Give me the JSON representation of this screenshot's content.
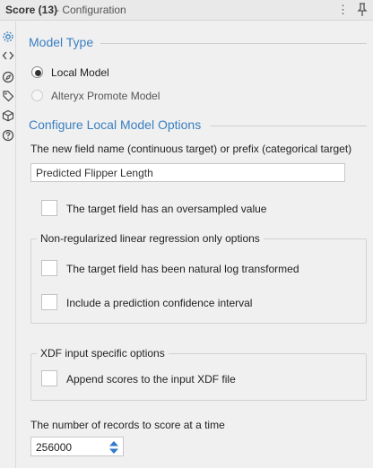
{
  "window": {
    "title": "Score (13)",
    "subtitle": "- Configuration"
  },
  "sidebar": {
    "icons": [
      "gear-icon",
      "code-icon",
      "compass-icon",
      "tag-icon",
      "cube-icon",
      "help-icon"
    ]
  },
  "model_type": {
    "heading": "Model Type",
    "options": [
      {
        "label": "Local Model",
        "selected": true
      },
      {
        "label": "Alteryx Promote Model",
        "selected": false
      }
    ]
  },
  "local_options": {
    "heading": "Configure Local Model Options",
    "field_name_label": "The new field name (continuous target) or prefix (categorical target)",
    "field_name_value": "Predicted Flipper Length",
    "oversampled_label": "The target field has an oversampled value",
    "linreg_group": {
      "title": "Non-regularized linear regression only options",
      "natural_log_label": "The target field has been natural log transformed",
      "confidence_label": "Include a prediction confidence interval"
    },
    "xdf_group": {
      "title": "XDF input specific options",
      "append_label": "Append scores to the input XDF file"
    },
    "records_label": "The number of records to score at a time",
    "records_value": "256000"
  }
}
